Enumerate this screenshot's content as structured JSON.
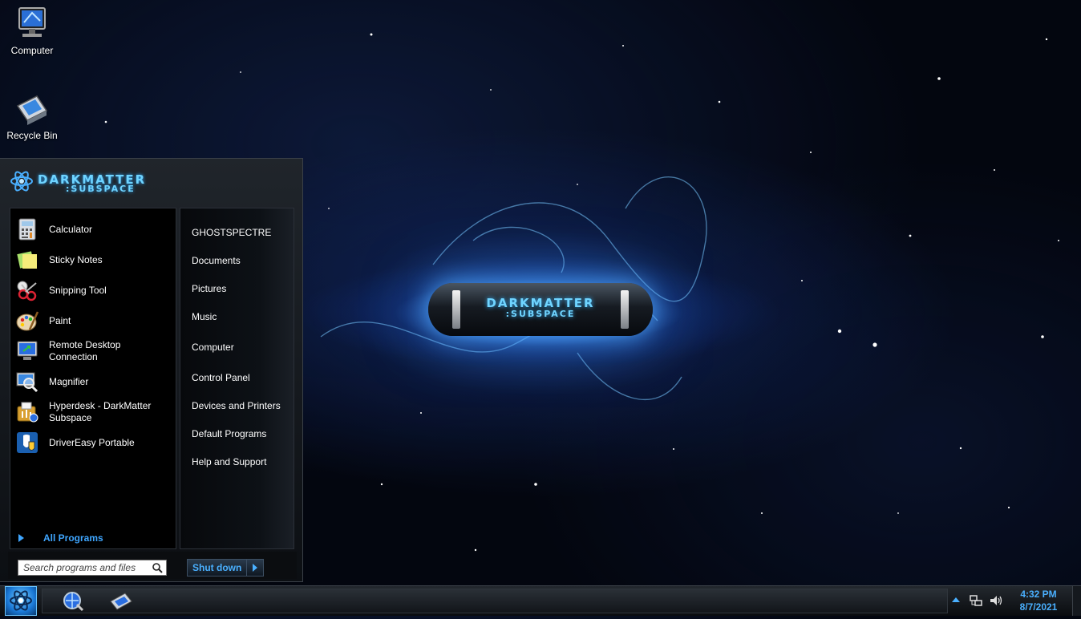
{
  "desktop": {
    "icons": [
      {
        "label": "Computer",
        "icon": "computer-monitor-icon"
      },
      {
        "label": "Recycle Bin",
        "icon": "recycle-bin-icon"
      }
    ],
    "wallpaper_logo": {
      "line1": "DARKMATTER",
      "line2": ":SUBSPACE"
    }
  },
  "start_menu": {
    "brand_line1": "DARKMATTER",
    "brand_line2": ":SUBSPACE",
    "programs": [
      {
        "label": "Calculator",
        "icon": "calculator-icon"
      },
      {
        "label": "Sticky Notes",
        "icon": "sticky-notes-icon"
      },
      {
        "label": "Snipping Tool",
        "icon": "scissors-icon"
      },
      {
        "label": "Paint",
        "icon": "paint-palette-icon"
      },
      {
        "label": "Remote Desktop\nConnection",
        "icon": "remote-desktop-icon"
      },
      {
        "label": "Magnifier",
        "icon": "magnifier-icon"
      },
      {
        "label": "Hyperdesk - DarkMatter\nSubspace",
        "icon": "hyperdesk-icon"
      },
      {
        "label": "DriverEasy Portable",
        "icon": "drivereasy-shield-icon"
      }
    ],
    "all_programs_label": "All Programs",
    "places": [
      "GHOSTSPECTRE",
      "Documents",
      "Pictures",
      "Music",
      "Computer",
      "Control Panel",
      "Devices and Printers",
      "Default Programs",
      "Help and Support"
    ],
    "search_placeholder": "Search programs and files",
    "shutdown_label": "Shut down"
  },
  "taskbar": {
    "pinned": [
      {
        "icon": "internet-browser-icon"
      },
      {
        "icon": "folder-window-icon"
      }
    ],
    "clock": {
      "time": "4:32 PM",
      "date": "8/7/2021"
    },
    "tray_icons": [
      "show-hidden-icons-arrow",
      "network-icon",
      "volume-icon"
    ]
  },
  "colors": {
    "accent": "#4ab0ff",
    "logo_glow": "#6fd4ff"
  }
}
